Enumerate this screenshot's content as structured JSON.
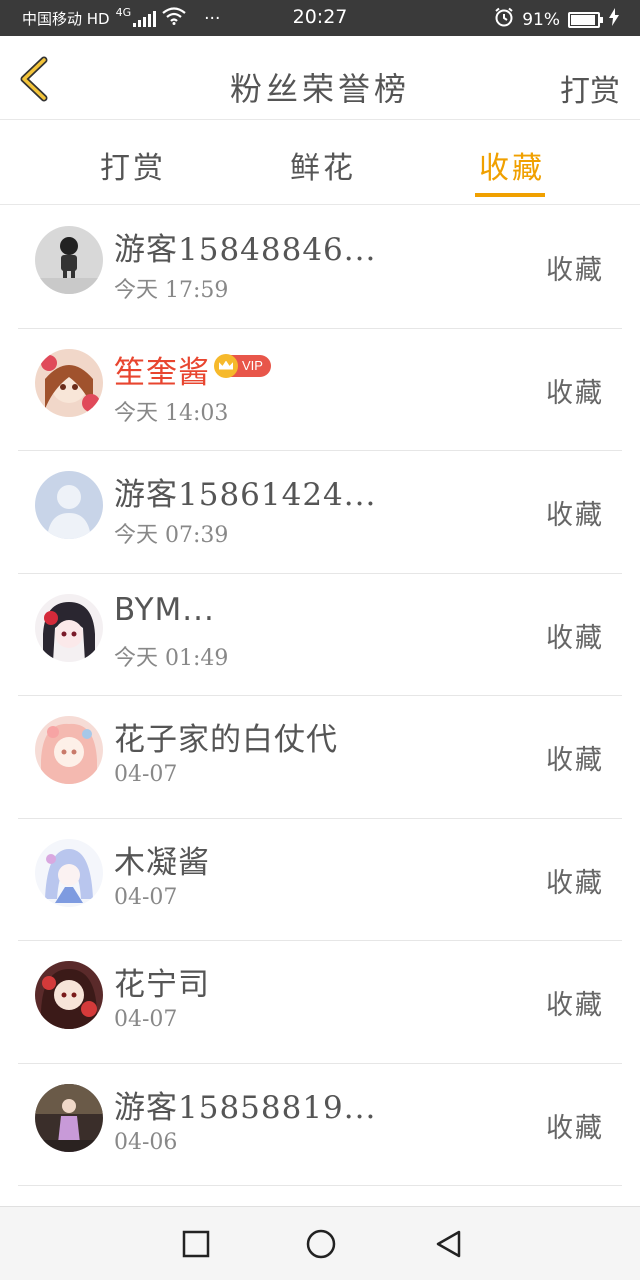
{
  "status_bar": {
    "carrier": "中国移动 HD",
    "network": "4G",
    "dots": "···",
    "time": "20:27",
    "battery": "91%"
  },
  "navbar": {
    "title": "粉丝荣誉榜",
    "action": "打赏"
  },
  "tabs": [
    {
      "label": "打赏",
      "active": false
    },
    {
      "label": "鲜花",
      "active": false
    },
    {
      "label": "收藏",
      "active": true
    }
  ],
  "list": [
    {
      "name": "游客15848846...",
      "time": "今天 17:59",
      "action": "收藏",
      "vip": false
    },
    {
      "name": "笙奎酱",
      "time": "今天 14:03",
      "action": "收藏",
      "vip": true,
      "vip_label": "VIP"
    },
    {
      "name": "游客15861424...",
      "time": "今天 07:39",
      "action": "收藏",
      "vip": false
    },
    {
      "name": "BYM...",
      "time": "今天 01:49",
      "action": "收藏",
      "vip": false
    },
    {
      "name": "花子家的白仗代",
      "time": "04-07",
      "action": "收藏",
      "vip": false
    },
    {
      "name": "木凝酱",
      "time": "04-07",
      "action": "收藏",
      "vip": false
    },
    {
      "name": "花宁司",
      "time": "04-07",
      "action": "收藏",
      "vip": false
    },
    {
      "name": "游客15858819...",
      "time": "04-06",
      "action": "收藏",
      "vip": false
    }
  ],
  "colors": {
    "accent": "#f0a000",
    "vip_name": "#e8452f"
  }
}
